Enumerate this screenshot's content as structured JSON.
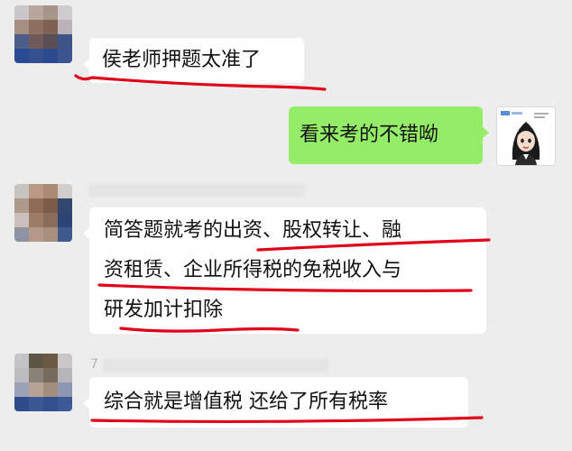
{
  "messages": [
    {
      "sender": "other",
      "text": "侯老师押题太准了"
    },
    {
      "sender": "self",
      "text": "看来考的不错呦"
    },
    {
      "sender": "other",
      "lines": [
        "简答题就考的出资、股权转让、融",
        "资租赁、企业所得税的免税收入与",
        "研发加计扣除"
      ]
    },
    {
      "sender": "other",
      "name_partial": "7",
      "text": "综合就是增值税 还给了所有税率"
    }
  ],
  "colors": {
    "background": "#ededed",
    "incoming_bubble": "#ffffff",
    "outgoing_bubble": "#95ec69",
    "annotation": "#e0001a"
  }
}
